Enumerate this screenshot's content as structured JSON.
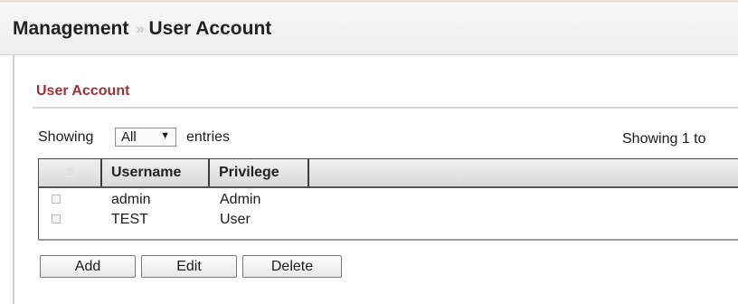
{
  "header": {
    "section": "Management",
    "separator": "»",
    "page": "User Account"
  },
  "panel": {
    "title": "User Account"
  },
  "entries": {
    "prefix": "Showing",
    "selected": "All",
    "suffix": "entries",
    "info": "Showing 1 to"
  },
  "table": {
    "columns": [
      "Username",
      "Privilege"
    ],
    "rows": [
      {
        "username": "admin",
        "privilege": "Admin"
      },
      {
        "username": "TEST",
        "privilege": "User"
      }
    ]
  },
  "buttons": {
    "add": "Add",
    "edit": "Edit",
    "delete": "Delete"
  },
  "icons": {
    "select_arrow": "▼",
    "breadcrumb_separator": "chevron-double-right-icon"
  },
  "colors": {
    "panel_title": "#a0303a"
  }
}
